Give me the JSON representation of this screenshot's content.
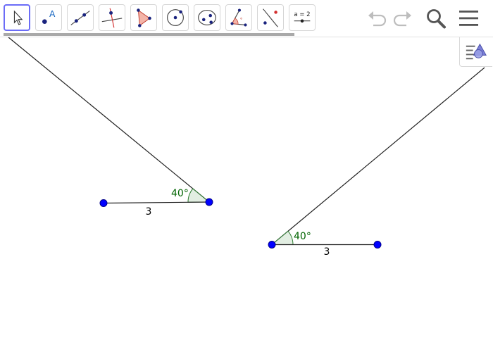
{
  "toolbar": {
    "tools": [
      {
        "id": "move",
        "icon": "move-cursor-icon"
      },
      {
        "id": "point",
        "icon": "point-icon",
        "glyph": "A"
      },
      {
        "id": "line",
        "icon": "line-icon"
      },
      {
        "id": "perpendicular",
        "icon": "perpendicular-line-icon"
      },
      {
        "id": "polygon",
        "icon": "polygon-icon"
      },
      {
        "id": "circle",
        "icon": "circle-icon"
      },
      {
        "id": "ellipse",
        "icon": "ellipse-icon"
      },
      {
        "id": "angle",
        "icon": "angle-icon"
      },
      {
        "id": "reflect",
        "icon": "reflect-icon"
      },
      {
        "id": "slider",
        "icon": "slider-icon",
        "glyph": "a = 2"
      }
    ],
    "undo_icon": "undo-icon",
    "redo_icon": "redo-icon",
    "search_icon": "search-icon",
    "menu_icon": "menu-icon",
    "style_icon": "style-bar-icon"
  },
  "construction": {
    "point_color": "#0000ff",
    "angle_color": "#006400",
    "left_figure": {
      "segment_label": "3",
      "angle_label": "40°"
    },
    "right_figure": {
      "segment_label": "3",
      "angle_label": "40°"
    }
  }
}
